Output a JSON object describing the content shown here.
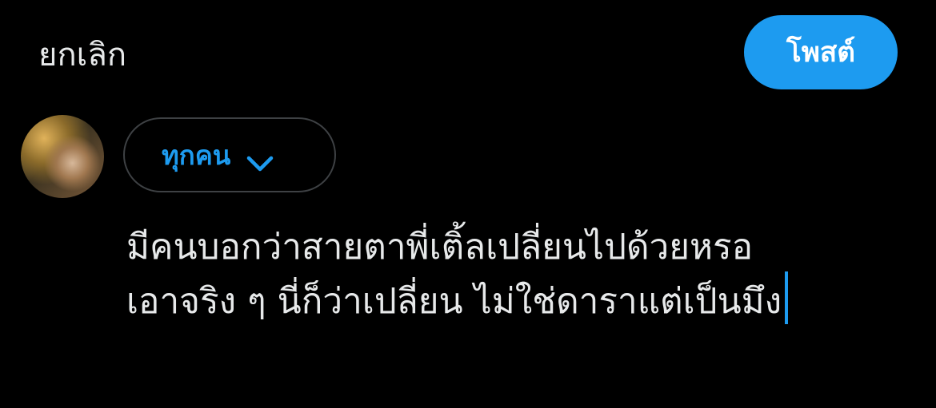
{
  "header": {
    "cancel_label": "ยกเลิก",
    "post_label": "โพสต์"
  },
  "audience": {
    "label": "ทุกคน",
    "chevron_icon": "chevron-down-icon"
  },
  "compose": {
    "lines": [
      "มีคนบอกว่าสายตาพี่เติ้ลเปลี่ยนไปด้วยหรอ",
      "เอาจริง ๆ นี่ก็ว่าเปลี่ยน ไม่ใช่ดาราแต่เป็นมึง"
    ]
  },
  "colors": {
    "background": "#000000",
    "accent": "#1D9BF0",
    "text": "#E7E9EA",
    "border": "#3E4144"
  }
}
